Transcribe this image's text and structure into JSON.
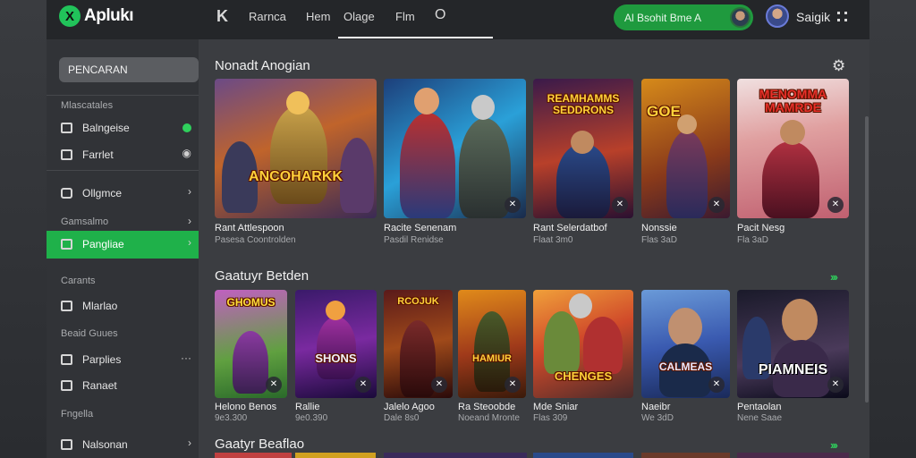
{
  "topbar": {
    "logo_mark": "X",
    "logo_text": "Aplukı",
    "back_icon": "K",
    "tabs": [
      "Rarnca",
      "Hem",
      "Olage",
      "Flm"
    ],
    "search_glyph": "O",
    "pill_text": "Al Bsohit Bme A",
    "user_name": "Saigik"
  },
  "sidebar": {
    "search_label": "PENCARAN",
    "heading_1": "Mlascatales",
    "item_1": "Balngeise",
    "item_2": "Farrlet",
    "item_3": "Ollgmce",
    "heading_2": "Gamsalmo",
    "item_active": "Pangliae",
    "heading_3": "Carants",
    "item_4": "Mlarlao",
    "heading_4": "Beaid Guues",
    "item_5": "Parplies",
    "item_6": "Ranaet",
    "heading_5": "Fngella",
    "item_7": "Nalsonan"
  },
  "main": {
    "section_1_title": "Nonadt Anogian",
    "section_2_title": "Gaatuyr Betden",
    "section_3_title": "Gaatyr Beaflao",
    "row1": [
      {
        "art": "ANCOHARKK",
        "title": "Rant Attlespoon",
        "sub": "Pasesa Coontrolden"
      },
      {
        "art": "",
        "title": "Racite Senenam",
        "sub": "Pasdil Renidse"
      },
      {
        "art": "REAMHAMMS SEDDRONS",
        "title": "Rant Selerdatbof",
        "sub": "Flaat 3m0"
      },
      {
        "art": "GOE",
        "title": "Nonssie",
        "sub": "Flas 3aD"
      },
      {
        "art": "MENOMMA MAMRDE",
        "title": "Pacit Nesg",
        "sub": "Fla 3aD"
      }
    ],
    "row2": [
      {
        "art": "GHOMUS",
        "title": "Helono Benos",
        "sub": "9e3.300"
      },
      {
        "art": "SHONS",
        "title": "Rallie",
        "sub": "9e0.390"
      },
      {
        "art": "RCOJUK",
        "title": "Jalelo Agoo",
        "sub": "Dale 8s0"
      },
      {
        "art": "HAMIUR",
        "title": "Ra Steoobde",
        "sub": "Noeand Mronte"
      },
      {
        "art": "CHENGES",
        "title": "Mde Sniar",
        "sub": "Flas 309"
      },
      {
        "art": "CALMEAS",
        "title": "Naeibr",
        "sub": "We 3dD"
      },
      {
        "art": "PIAMNEIS",
        "title": "Pentaolan",
        "sub": "Nene Saae"
      }
    ]
  }
}
